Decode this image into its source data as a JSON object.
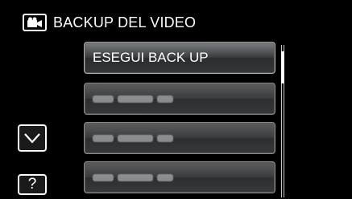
{
  "header": {
    "title": "BACKUP DEL VIDEO",
    "icon": "video-camera-icon"
  },
  "menu": {
    "items": [
      {
        "label": "ESEGUI BACK UP"
      }
    ]
  },
  "controls": {
    "scroll_down_icon": "chevron-down-icon",
    "help_label": "?"
  }
}
